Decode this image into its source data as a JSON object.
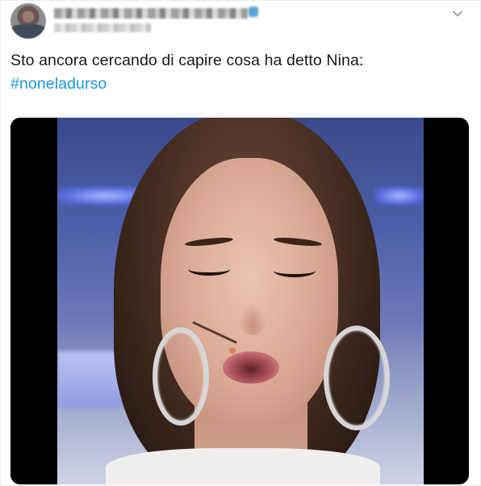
{
  "tweet": {
    "text": "Sto ancora cercando di capire cosa ha detto Nina:",
    "hashtag": "#noneladurso"
  },
  "icons": {
    "menu": "chevron-down-icon"
  },
  "colors": {
    "hashtag": "#1b95e0",
    "text": "#14171a",
    "border": "#e6ecf0"
  }
}
